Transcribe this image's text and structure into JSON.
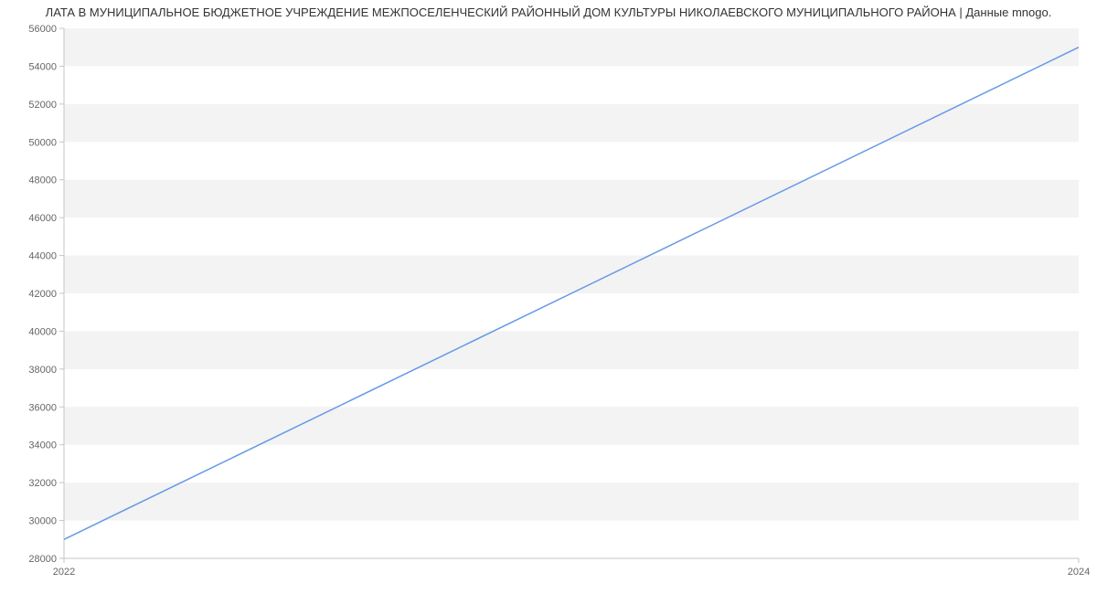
{
  "title": "ЛАТА В МУНИЦИПАЛЬНОЕ БЮДЖЕТНОЕ УЧРЕЖДЕНИЕ МЕЖПОСЕЛЕНЧЕСКИЙ РАЙОННЫЙ ДОМ КУЛЬТУРЫ НИКОЛАЕВСКОГО МУНИЦИПАЛЬНОГО РАЙОНА | Данные mnogo.",
  "chart_data": {
    "type": "line",
    "x": [
      2022,
      2024
    ],
    "values": [
      29000,
      55000
    ],
    "title": "ЛАТА В МУНИЦИПАЛЬНОЕ БЮДЖЕТНОЕ УЧРЕЖДЕНИЕ МЕЖПОСЕЛЕНЧЕСКИЙ РАЙОННЫЙ ДОМ КУЛЬТУРЫ НИКОЛАЕВСКОГО МУНИЦИПАЛЬНОГО РАЙОНА | Данные mnogo.",
    "xlabel": "",
    "ylabel": "",
    "ylim": [
      28000,
      56000
    ],
    "xlim": [
      2022,
      2024
    ],
    "y_ticks": [
      28000,
      30000,
      32000,
      34000,
      36000,
      38000,
      40000,
      42000,
      44000,
      46000,
      48000,
      50000,
      52000,
      54000,
      56000
    ],
    "x_ticks": [
      2022,
      2024
    ]
  }
}
